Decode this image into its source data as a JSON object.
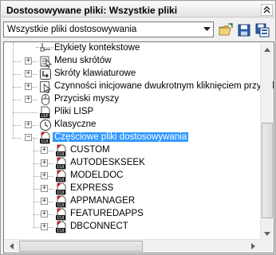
{
  "window": {
    "title": "Dostosowywane pliki: Wszystkie pliki"
  },
  "toolbar": {
    "dropdown_value": "Wszystkie pliki dostosowywania",
    "icons": [
      "open-folder-icon",
      "save-icon",
      "save-as-icon"
    ]
  },
  "tree": {
    "items": [
      {
        "label": "Etykiety kontekstowe",
        "icon": "context-tab-icon"
      },
      {
        "label": "Menu skrótów",
        "icon": "shortcut-menu-icon"
      },
      {
        "label": "Skróty klawiaturowe",
        "icon": "keyboard-shortcut-icon"
      },
      {
        "label": "Czynności inicjowane dwukrotnym kliknięciem przycisku",
        "icon": "double-click-icon"
      },
      {
        "label": "Przyciski myszy",
        "icon": "mouse-icon"
      },
      {
        "label": "Pliki LISP",
        "icon": "lisp-file-icon"
      },
      {
        "label": "Klasyczne",
        "icon": "clock-icon"
      },
      {
        "label": "Częściowe pliki dostosowywania",
        "icon": "cui-file-icon"
      },
      {
        "label": "CUSTOM",
        "icon": "cui-file-icon"
      },
      {
        "label": "AUTODESKSEEK",
        "icon": "cui-file-icon"
      },
      {
        "label": "MODELDOC",
        "icon": "cui-file-icon"
      },
      {
        "label": "EXPRESS",
        "icon": "cui-file-icon"
      },
      {
        "label": "APPMANAGER",
        "icon": "cui-file-icon"
      },
      {
        "label": "FEATUREDAPPS",
        "icon": "cui-file-icon"
      },
      {
        "label": "DBCONNECT",
        "icon": "cui-file-icon"
      }
    ],
    "selected": "Częściowe pliki dostosowywania",
    "cui_badge": "CUI",
    "lisp_badge": "LSP"
  },
  "colors": {
    "selection": "#3399ff",
    "cui_red": "#cc2222"
  }
}
